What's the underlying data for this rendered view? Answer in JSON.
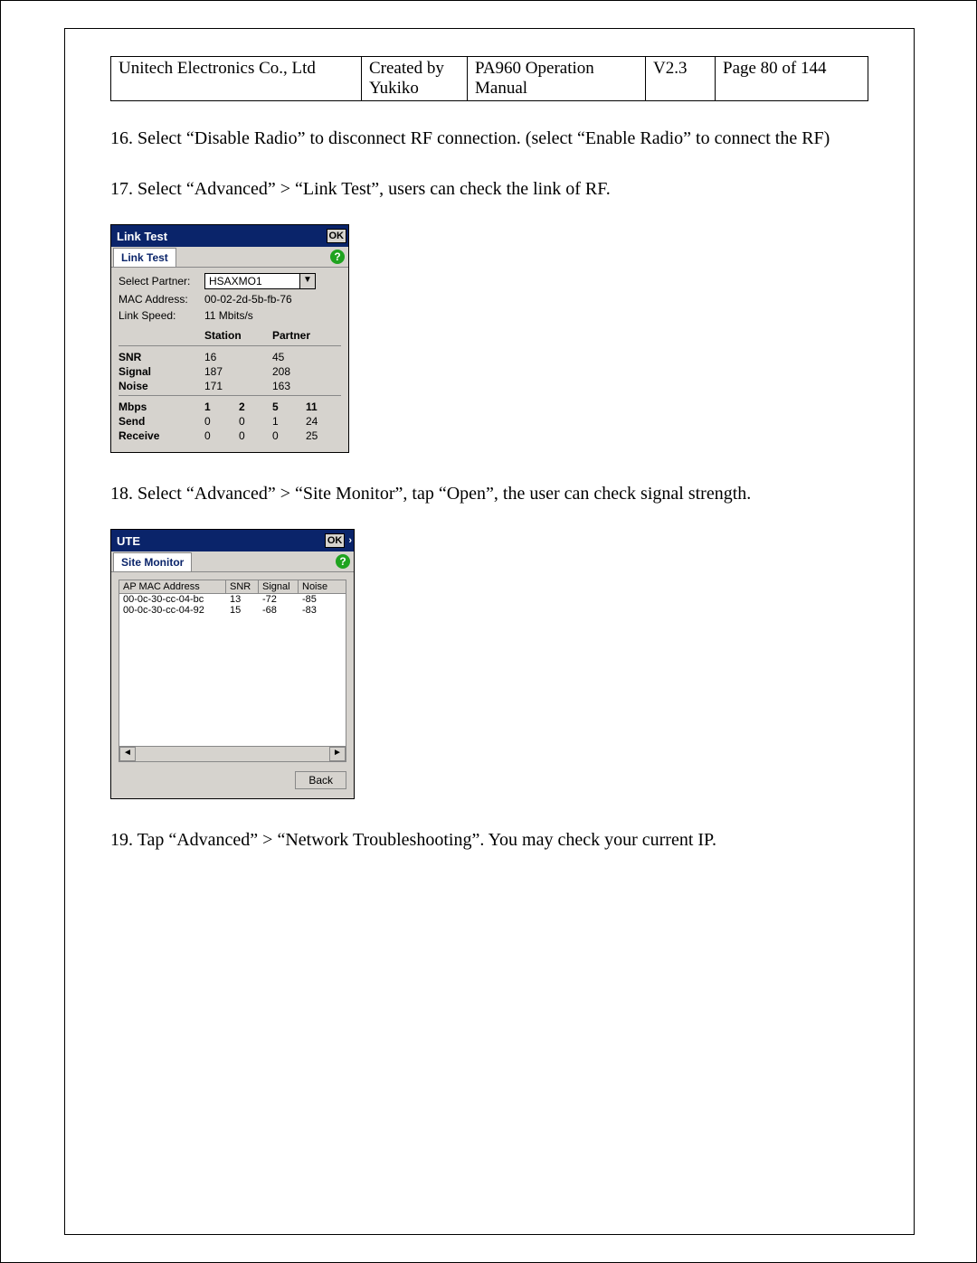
{
  "header": {
    "company": "Unitech Electronics Co., Ltd",
    "created": "Created by Yukiko",
    "doc": "PA960 Operation Manual",
    "version": "V2.3",
    "page": "Page 80 of 144"
  },
  "para16": "16. Select “Disable Radio” to disconnect RF connection. (select “Enable Radio” to connect the RF)",
  "para17": "17. Select “Advanced” > “Link Test”, users can check the link of RF.",
  "para18": "18. Select “Advanced” > “Site Monitor”, tap “Open”, the user can check signal strength.",
  "para19": "19. Tap “Advanced” > “Network Troubleshooting”. You may check your current IP.",
  "linktest": {
    "title": "Link Test",
    "tab": "Link Test",
    "ok": "OK",
    "help": "?",
    "select_partner_label": "Select Partner:",
    "select_partner_value": "HSAXMO1",
    "mac_label": "MAC Address:",
    "mac_value": "00-02-2d-5b-fb-76",
    "linkspeed_label": "Link Speed:",
    "linkspeed_value": "11 Mbits/s",
    "col_station": "Station",
    "col_partner": "Partner",
    "rows1": [
      {
        "label": "SNR",
        "station": "16",
        "partner": "45"
      },
      {
        "label": "Signal",
        "station": "187",
        "partner": "208"
      },
      {
        "label": "Noise",
        "station": "171",
        "partner": "163"
      }
    ],
    "rows2": [
      {
        "label": "Mbps",
        "c1": "1",
        "c2": "2",
        "c3": "5",
        "c4": "11"
      },
      {
        "label": "Send",
        "c1": "0",
        "c2": "0",
        "c3": "1",
        "c4": "24"
      },
      {
        "label": "Receive",
        "c1": "0",
        "c2": "0",
        "c3": "0",
        "c4": "25"
      }
    ]
  },
  "sitemonitor": {
    "title": "UTE",
    "tab": "Site Monitor",
    "ok": "OK",
    "help": "?",
    "col_mac": "AP MAC Address",
    "col_snr": "SNR",
    "col_signal": "Signal",
    "col_noise": "Noise",
    "rows": [
      {
        "mac": "00-0c-30-cc-04-bc",
        "snr": "13",
        "signal": "-72",
        "noise": "-85"
      },
      {
        "mac": "00-0c-30-cc-04-92",
        "snr": "15",
        "signal": "-68",
        "noise": "-83"
      }
    ],
    "back": "Back"
  }
}
